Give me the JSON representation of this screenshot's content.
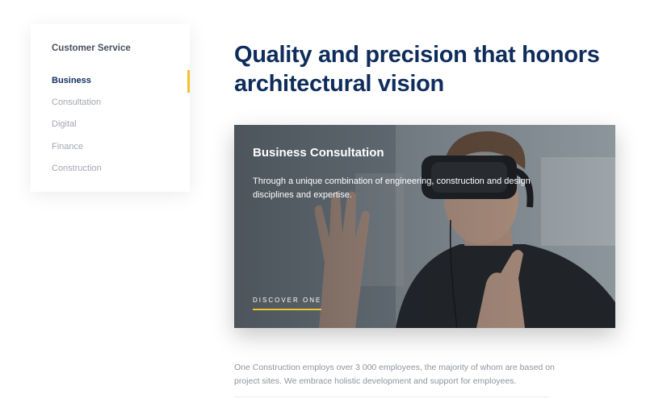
{
  "sidebar": {
    "title": "Customer Service",
    "items": [
      {
        "label": "Business",
        "active": true
      },
      {
        "label": "Consultation",
        "active": false
      },
      {
        "label": "Digital",
        "active": false
      },
      {
        "label": "Finance",
        "active": false
      },
      {
        "label": "Construction",
        "active": false
      }
    ]
  },
  "main": {
    "heading": "Quality and precision that honors architectural vision",
    "card": {
      "title": "Business Consultation",
      "description": "Through a unique combination of engineering, construction and design disciplines and expertise.",
      "link_label": "DISCOVER ONE",
      "image_subject": "man-wearing-vr-headset"
    },
    "body": "One Construction employs over 3 000 employees, the majority of whom are based on project sites. We embrace holistic development and support for employees."
  },
  "colors": {
    "navy": "#0f2d5c",
    "accent": "#f2c12e",
    "muted": "#a3a7b0",
    "body_text": "#8e939b"
  }
}
